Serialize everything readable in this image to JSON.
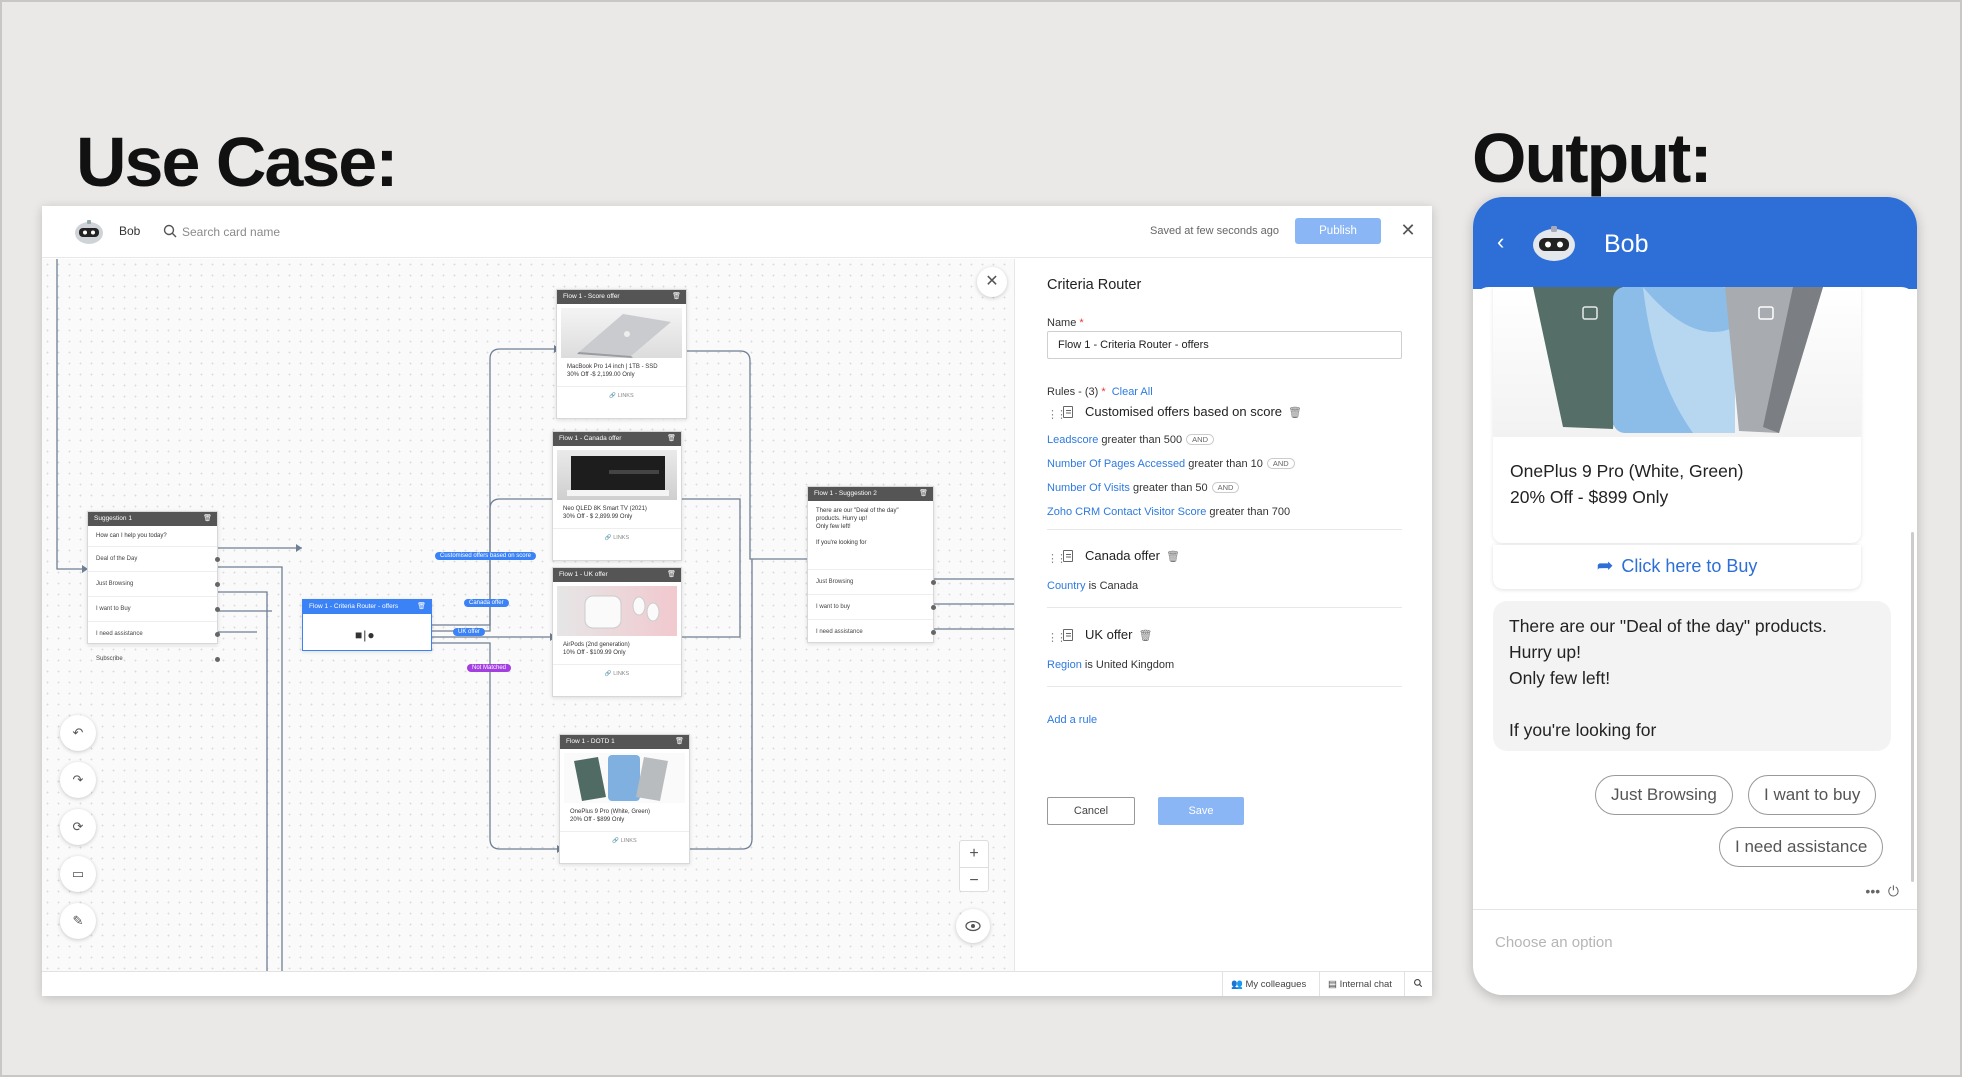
{
  "headings": {
    "use_case": "Use Case:",
    "output": "Output:"
  },
  "builder": {
    "bot_name": "Bob",
    "search_placeholder": "Search card name",
    "saved_status": "Saved at few seconds ago",
    "publish_label": "Publish",
    "close_label": "✕",
    "cards": {
      "suggestion1": {
        "title": "Suggestion 1",
        "question": "How can I help you today?",
        "options": [
          "Deal of the Day",
          "Just Browsing",
          "I want to Buy",
          "I need assistance",
          "Subscribe"
        ]
      },
      "router": {
        "title": "Flow 1 - Criteria Router - offers",
        "icon_text": "■|●"
      },
      "score_offer": {
        "title": "Flow 1 - Score offer",
        "text_line1": "MacBook Pro 14 inch | 1TB - SSD",
        "text_line2": "30% Off -$ 2,199.00 Only",
        "links": "🔗 LINKS"
      },
      "canada_offer": {
        "title": "Flow 1 - Canada offer",
        "text_line1": "Neo QLED 8K Smart TV (2021)",
        "text_line2": "30% Off - $ 2,899.99 Only",
        "links": "🔗 LINKS"
      },
      "uk_offer": {
        "title": "Flow 1 - UK offer",
        "text_line1": "AirPods (2nd generation)",
        "text_line2": "10% Off - $109.99 Only",
        "links": "🔗 LINKS"
      },
      "dotd": {
        "title": "Flow 1 - DOTD 1",
        "text_line1": "OnePlus 9 Pro (White, Green)",
        "text_line2": "20% Off - $899 Only",
        "links": "🔗 LINKS"
      },
      "suggestion2": {
        "title": "Flow 1 - Suggestion 2",
        "lines": [
          "There are our \"Deal of the day\"",
          "products. Hurry up!",
          "Only few left!",
          "",
          "If you're looking for"
        ],
        "options": [
          "Just Browsing",
          "I want to buy",
          "I need assistance"
        ]
      }
    },
    "tags": {
      "score": "Customised offers based on score",
      "canada": "Canada offer",
      "uk": "UK offer",
      "not_matched": "Not Matched"
    },
    "tools": [
      "undo",
      "redo",
      "refresh",
      "preview",
      "pin"
    ],
    "zoom": {
      "plus": "+",
      "minus": "−"
    },
    "panel": {
      "title": "Criteria Router",
      "name_label": "Name",
      "required_mark": "*",
      "name_value": "Flow 1 - Criteria Router - offers",
      "rules_label": "Rules - (3)",
      "clear_all": "Clear All",
      "rules": [
        {
          "name": "Customised offers based on score",
          "conditions": [
            {
              "field": "Leadscore",
              "rest": " greater than 500",
              "joiner": "AND"
            },
            {
              "field": "Number Of Pages Accessed",
              "rest": " greater than 10",
              "joiner": "AND"
            },
            {
              "field": "Number Of Visits",
              "rest": " greater than 50",
              "joiner": "AND"
            },
            {
              "field": "Zoho CRM Contact Visitor Score",
              "rest": " greater than 700",
              "joiner": ""
            }
          ]
        },
        {
          "name": "Canada offer",
          "conditions": [
            {
              "field": "Country",
              "rest": " is Canada",
              "joiner": ""
            }
          ]
        },
        {
          "name": "UK offer",
          "conditions": [
            {
              "field": "Region",
              "rest": " is United Kingdom",
              "joiner": ""
            }
          ]
        }
      ],
      "add_rule": "Add a rule",
      "cancel": "Cancel",
      "save": "Save"
    },
    "bottom_bar": {
      "colleagues": "My colleagues",
      "internal_chat": "Internal chat"
    }
  },
  "chat": {
    "bot_name": "Bob",
    "product_name": "OnePlus 9 Pro (White, Green)",
    "product_price": "20% Off - $899 Only",
    "buy_label": "Click here to Buy",
    "message_lines": [
      "There are our \"Deal of the day\" products.",
      "Hurry up!",
      "Only few left!",
      "",
      "If you're looking for"
    ],
    "chips": [
      "Just Browsing",
      "I want to buy",
      "I need assistance"
    ],
    "input_placeholder": "Choose an option",
    "accent_color": "#2d6fd6"
  }
}
